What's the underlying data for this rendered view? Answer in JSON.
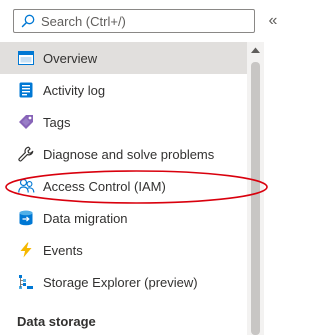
{
  "search": {
    "placeholder": "Search (Ctrl+/)"
  },
  "collapse": {
    "glyph": "«"
  },
  "menu": {
    "items": [
      {
        "label": "Overview",
        "icon": "overview-icon"
      },
      {
        "label": "Activity log",
        "icon": "activity-log-icon"
      },
      {
        "label": "Tags",
        "icon": "tag-icon"
      },
      {
        "label": "Diagnose and solve problems",
        "icon": "wrench-icon"
      },
      {
        "label": "Access Control (IAM)",
        "icon": "people-icon"
      },
      {
        "label": "Data migration",
        "icon": "data-migration-icon"
      },
      {
        "label": "Events",
        "icon": "lightning-icon"
      },
      {
        "label": "Storage Explorer (preview)",
        "icon": "storage-explorer-icon"
      }
    ],
    "selected_index": 0
  },
  "section": {
    "data_storage": "Data storage"
  },
  "colors": {
    "selected_bg": "#e1dfdd",
    "annotation_ring": "#d9000d",
    "accent_blue": "#0078d4"
  }
}
